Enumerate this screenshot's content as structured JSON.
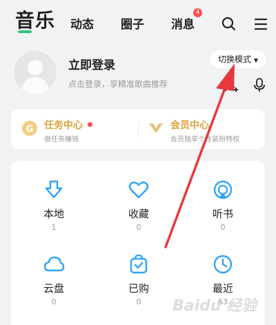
{
  "top_nav": {
    "tabs": [
      {
        "label": "音乐",
        "active": true
      },
      {
        "label": "动态"
      },
      {
        "label": "圈子"
      },
      {
        "label": "消息",
        "badge": "4"
      }
    ],
    "icons": [
      "search-icon",
      "menu-icon"
    ],
    "accent_color": "#31c27c"
  },
  "profile": {
    "title": "立即登录",
    "subtitle": "点击登录，享精准歌曲推荐",
    "mode_button": "切换模式",
    "icons": [
      "add-friend-icon",
      "voice-icon"
    ]
  },
  "promo": {
    "task": {
      "title": "任务中心",
      "subtitle": "做任务赚钱"
    },
    "vip": {
      "title": "会员中心",
      "subtitle": "会员独享个性装扮特权"
    },
    "title_color": "#d9a23c"
  },
  "grid": [
    {
      "label": "本地",
      "count": "1",
      "icon": "download-icon"
    },
    {
      "label": "收藏",
      "count": "0",
      "icon": "heart-icon"
    },
    {
      "label": "听书",
      "count": "0",
      "icon": "audiobook-icon"
    },
    {
      "label": "云盘",
      "count": "0",
      "icon": "cloud-icon"
    },
    {
      "label": "已购",
      "count": "0",
      "icon": "purchased-bag-icon"
    },
    {
      "label": "最近",
      "count": "63",
      "icon": "clock-icon"
    }
  ],
  "icon_color": "#2fa3f6",
  "watermark": "Baidu 经验"
}
